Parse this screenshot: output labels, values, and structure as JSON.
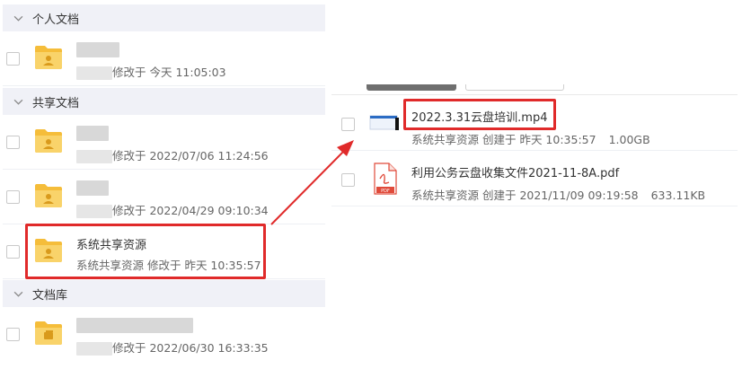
{
  "left": {
    "sections": [
      {
        "title": "个人文档"
      },
      {
        "title": "共享文档"
      },
      {
        "title": "文档库"
      }
    ],
    "rows": [
      {
        "name": "",
        "meta_prefix": "修改于 今天 11:05:03"
      },
      {
        "name": "",
        "meta_prefix": "修改于 2022/07/06 11:24:56"
      },
      {
        "name": "",
        "meta_prefix": "修改于 2022/04/29 09:10:34"
      },
      {
        "name": "系统共享资源",
        "meta_prefix": "系统共享资源 修改于 昨天 10:35:57"
      },
      {
        "name": "",
        "meta_prefix": "修改于 2022/06/30 16:33:35"
      }
    ]
  },
  "right": {
    "files": [
      {
        "name": "2022.3.31云盘培训.mp4",
        "meta": "系统共享资源 创建于 昨天 10:35:57",
        "size": "1.00GB",
        "type": "video"
      },
      {
        "name": "利用公务云盘收集文件2021-11-8A.pdf",
        "meta": "系统共享资源 创建于 2021/11/09 09:19:58",
        "size": "633.11KB",
        "type": "pdf"
      }
    ]
  },
  "icons": {
    "chevron": "chevron-down-icon",
    "folder": "folder-user-icon",
    "library": "folder-library-icon",
    "pdf": "pdf-icon",
    "video": "video-icon"
  },
  "colors": {
    "highlight": "#e02a2a",
    "section_bg": "#f0f1f7",
    "folder_yellow": "#f7c948"
  }
}
